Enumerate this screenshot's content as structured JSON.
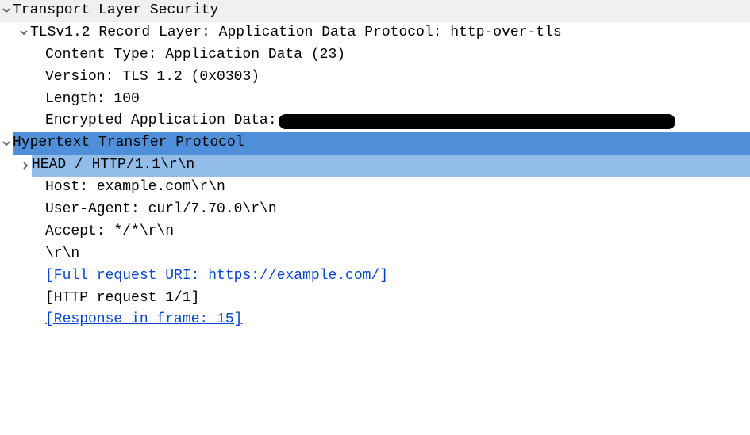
{
  "tls": {
    "title": "Transport Layer Security",
    "record": {
      "title": "TLSv1.2 Record Layer: Application Data Protocol: http-over-tls",
      "content_type": "Content Type: Application Data (23)",
      "version": "Version: TLS 1.2 (0x0303)",
      "length": "Length: 100",
      "encrypted_label": "Encrypted Application Data:"
    }
  },
  "http": {
    "title": "Hypertext Transfer Protocol",
    "request_line": "HEAD / HTTP/1.1\\r\\n",
    "host": "Host: example.com\\r\\n",
    "user_agent": "User-Agent: curl/7.70.0\\r\\n",
    "accept": "Accept: */*\\r\\n",
    "crlf": "\\r\\n",
    "full_uri": "[Full request URI: https://example.com/]",
    "req_num": "[HTTP request 1/1]",
    "response_frame": "[Response in frame: 15]"
  }
}
